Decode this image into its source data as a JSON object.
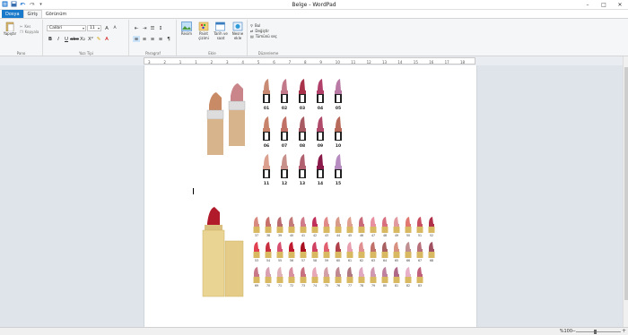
{
  "window": {
    "title": "Belge - WordPad"
  },
  "tabs": [
    {
      "label": "Dosya"
    },
    {
      "label": "Giriş"
    },
    {
      "label": "Görünüm"
    }
  ],
  "clipboard": {
    "paste": "Yapıştır",
    "cut": "Kes",
    "copy": "Kopyala",
    "group": "Pano"
  },
  "font": {
    "family": "Calibri",
    "size": "11",
    "group": "Yazı Tipi"
  },
  "paragraph": {
    "group": "Paragraf"
  },
  "insert": {
    "picture": "Resim",
    "paint": "Paint çizimi",
    "datetime": "Tarih ve saat",
    "object": "Nesne ekle",
    "group": "Ekle"
  },
  "editing": {
    "find": "Bul",
    "replace": "Değiştir",
    "select_all": "Tümünü seç",
    "group": "Düzenleme"
  },
  "ruler": {
    "marks": [
      "3",
      "2",
      "1",
      "1",
      "2",
      "3",
      "4",
      "5",
      "6",
      "7",
      "8",
      "9",
      "10",
      "11",
      "12",
      "13",
      "14",
      "15",
      "16",
      "17",
      "18"
    ]
  },
  "swatches_top": {
    "labels": [
      "01",
      "02",
      "03",
      "04",
      "05",
      "06",
      "07",
      "08",
      "09",
      "10",
      "11",
      "12",
      "13",
      "14",
      "15"
    ],
    "colors": [
      "#c98a74",
      "#c27a8a",
      "#a8324a",
      "#b0406a",
      "#b97aa5",
      "#c9826a",
      "#c07065",
      "#a85a62",
      "#b04a6a",
      "#b86a5a",
      "#dba08e",
      "#c8908a",
      "#b0606e",
      "#8a1a4a",
      "#b78cc0"
    ]
  },
  "swatches_bottom": {
    "labels": [
      "37",
      "38",
      "39",
      "40",
      "41",
      "42",
      "43",
      "44",
      "45",
      "46",
      "47",
      "48",
      "49",
      "50",
      "51",
      "52",
      "53",
      "54",
      "55",
      "56",
      "57",
      "58",
      "59",
      "60",
      "61",
      "62",
      "63",
      "64",
      "65",
      "66",
      "67",
      "68",
      "69",
      "70",
      "71",
      "72",
      "73",
      "74",
      "75",
      "76",
      "77",
      "78",
      "79",
      "80",
      "81",
      "82",
      "83"
    ]
  },
  "status": {
    "zoom": "%100"
  }
}
